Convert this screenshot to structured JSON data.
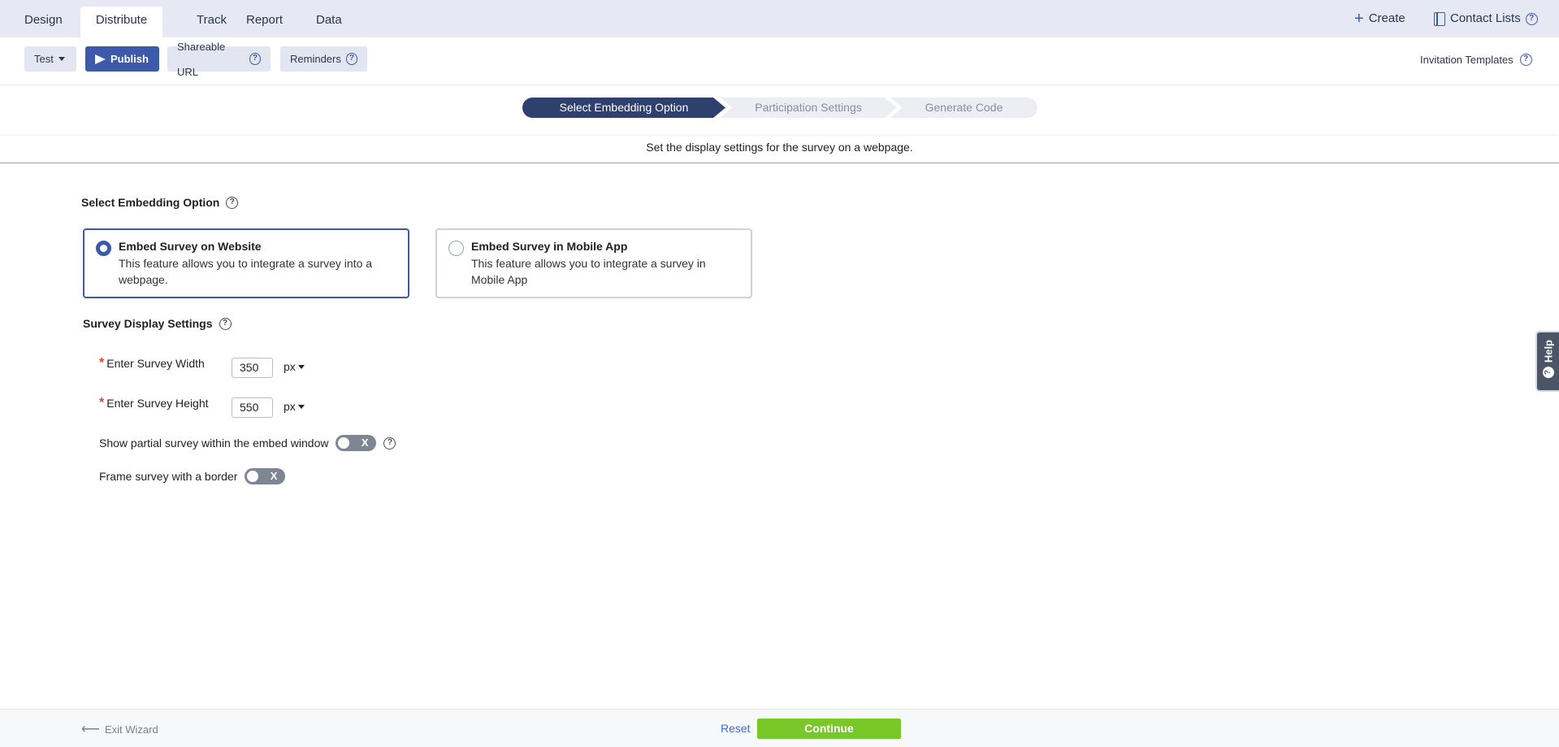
{
  "top_tabs": [
    {
      "label": "Design"
    },
    {
      "label": "Distribute"
    },
    {
      "label": "Track"
    },
    {
      "label": "Report"
    },
    {
      "label": "Data"
    }
  ],
  "top_right": {
    "create_label": "Create",
    "contact_lists_label": "Contact Lists"
  },
  "toolbar": {
    "test_label": "Test",
    "publish_label": "Publish",
    "shareable_url_label": "Shareable URL",
    "reminders_label": "Reminders",
    "invitation_templates_label": "Invitation Templates"
  },
  "wizard": {
    "steps": [
      {
        "label": "Select Embedding Option",
        "active": true
      },
      {
        "label": "Participation Settings",
        "active": false
      },
      {
        "label": "Generate Code",
        "active": false
      }
    ],
    "subtitle": "Set the display settings for the survey on a webpage."
  },
  "embedding": {
    "title": "Select Embedding Option",
    "options": [
      {
        "title": "Embed Survey on Website",
        "description": "This feature allows you to integrate a survey into a webpage.",
        "selected": true
      },
      {
        "title": "Embed Survey in Mobile App",
        "description": "This feature allows you to integrate a survey in Mobile App",
        "selected": false
      }
    ]
  },
  "display_settings": {
    "title": "Survey Display Settings",
    "width_label": "Enter Survey Width",
    "width_value": "350",
    "width_unit": "px",
    "height_label": "Enter Survey Height",
    "height_value": "550",
    "height_unit": "px",
    "partial_label": "Show partial survey within the embed window",
    "partial_toggle": "X",
    "border_label": "Frame survey with a border",
    "border_toggle": "X"
  },
  "help_tab": {
    "label": "Help"
  },
  "footer": {
    "exit_label": "Exit Wizard",
    "reset_label": "Reset",
    "continue_label": "Continue"
  },
  "colors": {
    "accent": "#3d5aa8",
    "step_active": "#2f3f6e",
    "continue_green": "#7ac72a",
    "required_red": "#e4472b"
  }
}
